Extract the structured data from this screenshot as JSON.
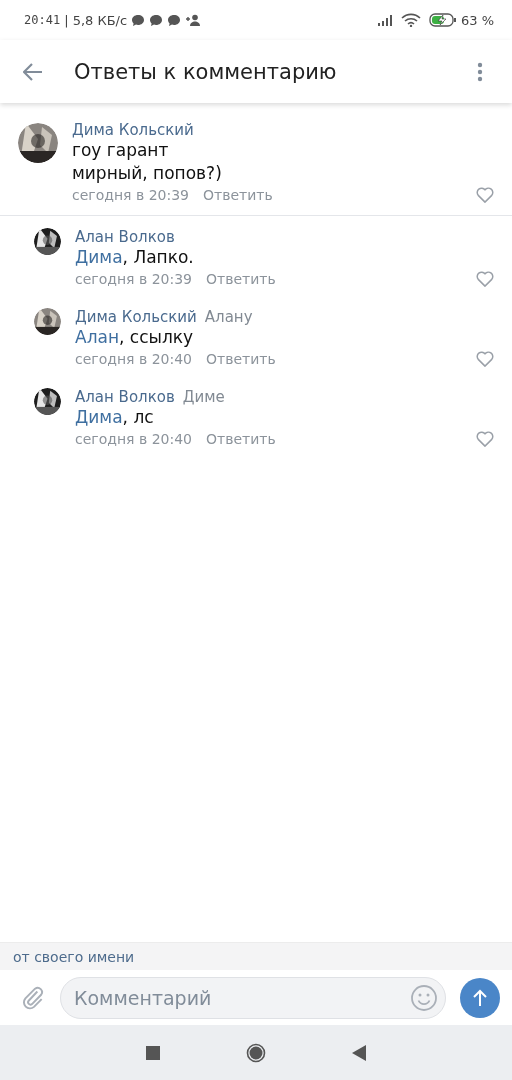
{
  "status_bar": {
    "time": "20:41",
    "speed": "| 5,8 КБ/с",
    "battery_text": "63 %",
    "charging": true
  },
  "header": {
    "title": "Ответы к комментарию"
  },
  "root_comment": {
    "author": "Дима Кольский",
    "lines": [
      "гоу гарант",
      "мирный, попов?)"
    ],
    "time": "сегодня в 20:39",
    "reply_label": "Ответить",
    "liked": false
  },
  "replies": [
    {
      "author": "Алан Волков",
      "mention": "Дима",
      "text": ", Лапко.",
      "time": "сегодня в 20:39",
      "reply_label": "Ответить",
      "liked": false
    },
    {
      "author": "Дима Кольский",
      "reply_to": "Алану",
      "mention": "Алан",
      "text": ", ссылку",
      "time": "сегодня в 20:40",
      "reply_label": "Ответить",
      "liked": false
    },
    {
      "author": "Алан Волков",
      "reply_to": "Диме",
      "mention": "Дима",
      "text": ", лс",
      "time": "сегодня в 20:40",
      "reply_label": "Ответить",
      "liked": false
    }
  ],
  "composer": {
    "identity": "от своего имени",
    "placeholder": "Комментарий"
  }
}
